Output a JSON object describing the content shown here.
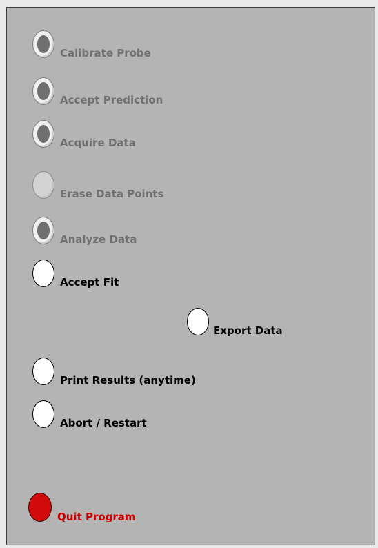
{
  "buttons": {
    "calibrate_probe": "Calibrate Probe",
    "accept_prediction": "Accept Prediction",
    "acquire_data": "Acquire Data",
    "erase_data_points": "Erase Data Points",
    "analyze_data": "Analyze Data",
    "accept_fit": "Accept Fit",
    "export_data": "Export Data",
    "print_results": "Print Results (anytime)",
    "abort_restart": "Abort / Restart",
    "quit_program": "Quit Program"
  },
  "colors": {
    "panel_background": "#b4b4b4",
    "quit_button": "#d10a0a",
    "quit_label": "#cc0000",
    "disabled_label": "#707070"
  }
}
